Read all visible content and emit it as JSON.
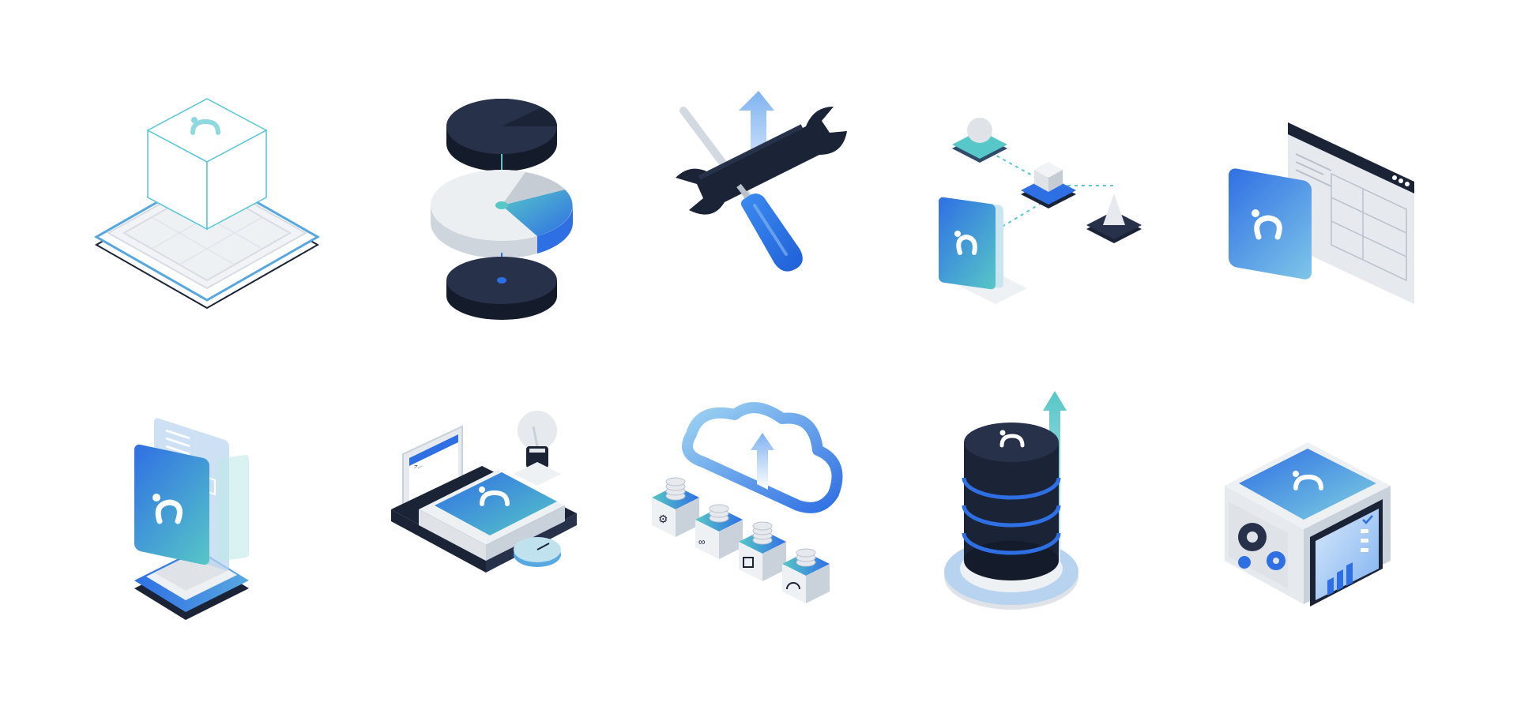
{
  "title": "",
  "colors": {
    "navy": "#1b2336",
    "blue": "#2f6fe4",
    "light_blue": "#7fb2f0",
    "teal": "#57c7c7",
    "light_gray": "#e6e9ee",
    "gray_line": "#c9d1da",
    "white": "#ffffff"
  },
  "icons": [
    "wireframe-cube-platform-icon",
    "pie-chart-stack-icon",
    "wrench-screwdriver-upload-icon",
    "shape-flow-logo-icon",
    "app-window-logo-icon",
    "document-stack-logo-icon",
    "laptop-toolbox-lightbulb-icon",
    "cloud-upload-coins-icon",
    "database-growth-arrow-icon",
    "server-box-gears-chart-icon"
  ]
}
